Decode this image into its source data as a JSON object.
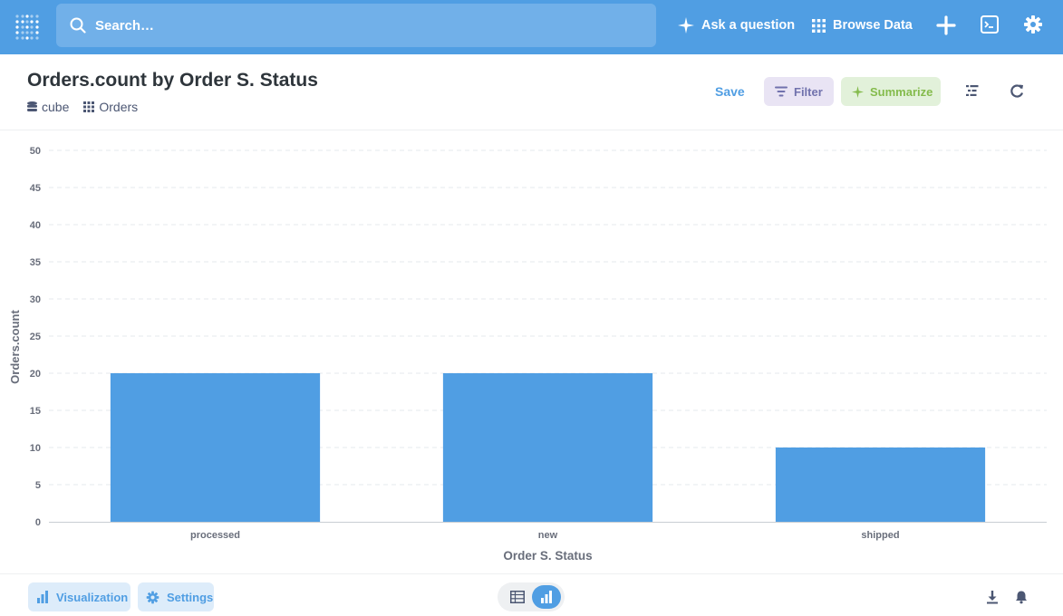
{
  "nav": {
    "search_placeholder": "Search…",
    "ask_question_label": "Ask a question",
    "browse_data_label": "Browse Data"
  },
  "header": {
    "title": "Orders.count by Order S. Status",
    "breadcrumbs": [
      "cube",
      "Orders"
    ],
    "save_label": "Save",
    "filter_label": "Filter",
    "summarize_label": "Summarize"
  },
  "chart_data": {
    "type": "bar",
    "categories": [
      "processed",
      "new",
      "shipped"
    ],
    "values": [
      20,
      20,
      10
    ],
    "xlabel": "Order S. Status",
    "ylabel": "Orders.count",
    "ylim": [
      0,
      50
    ],
    "yticks": [
      0,
      5,
      10,
      15,
      20,
      25,
      30,
      35,
      40,
      45,
      50
    ],
    "grid": true,
    "bar_color": "#509ee3"
  },
  "footer": {
    "visualization_label": "Visualization",
    "settings_label": "Settings"
  },
  "colors": {
    "brand": "#509ee3",
    "filter": "#7172ad",
    "summarize": "#84bb4c"
  }
}
